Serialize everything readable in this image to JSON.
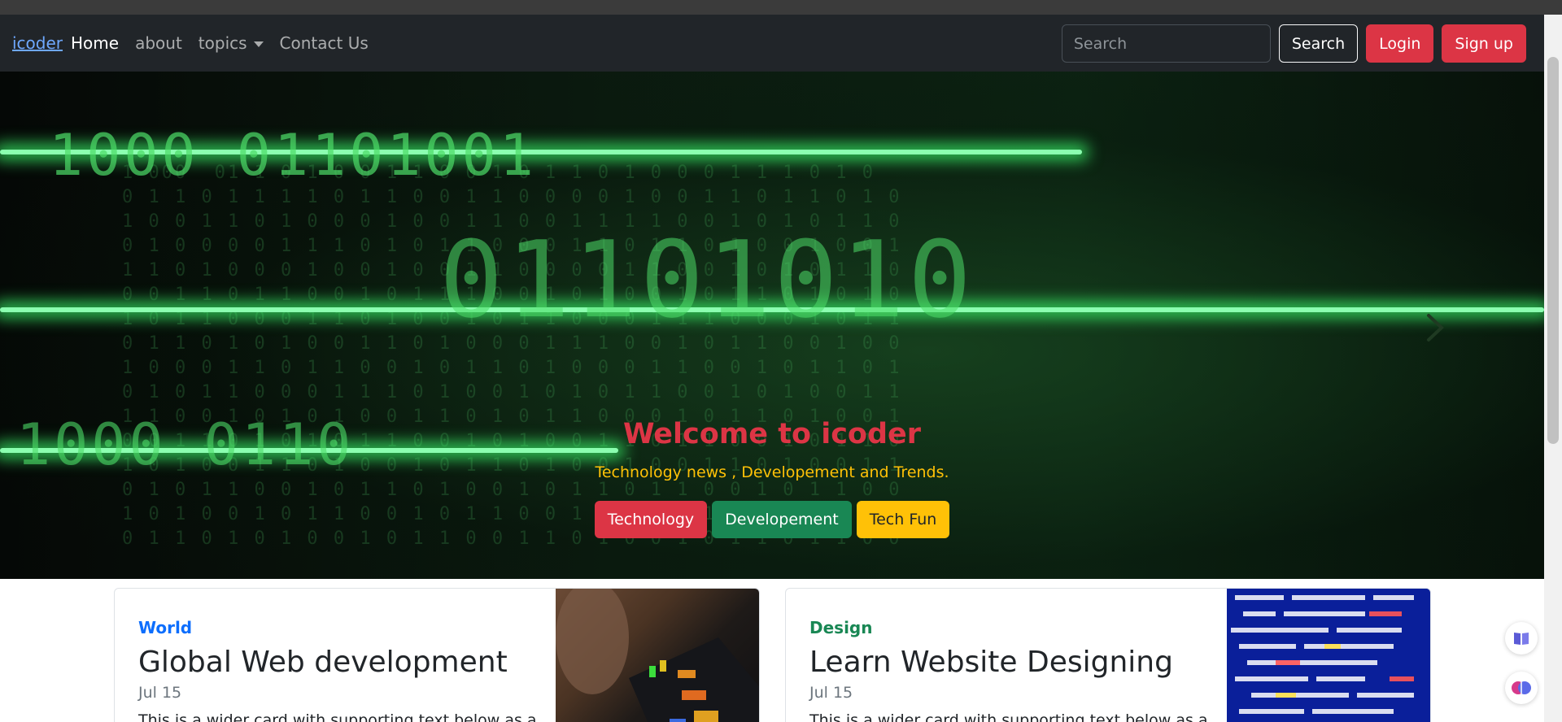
{
  "navbar": {
    "brand": "icoder",
    "links": [
      {
        "label": "Home"
      },
      {
        "label": "about"
      },
      {
        "label": "topics"
      },
      {
        "label": "Contact Us"
      }
    ],
    "search_placeholder": "Search",
    "search_button": "Search",
    "login_button": "Login",
    "signup_button": "Sign up"
  },
  "hero": {
    "title": "Welcome to icoder",
    "subtitle": "Technology news , Developement and Trends.",
    "buttons": [
      {
        "label": "Technology"
      },
      {
        "label": "Developement"
      },
      {
        "label": "Tech Fun"
      }
    ],
    "binary_rows": [
      "1000 01101001",
      "01101010",
      "1000 0110"
    ]
  },
  "cards": [
    {
      "category": "World",
      "title": "Global Web development",
      "date": "Jul 15",
      "text": "This is a wider card with supporting text below as a"
    },
    {
      "category": "Design",
      "title": "Learn Website Designing",
      "date": "Jul 15",
      "text": "This is a wider card with supporting text below as a"
    }
  ],
  "colors": {
    "navbar_bg": "#212529",
    "danger": "#dc3545",
    "success": "#198754",
    "warning": "#ffc107",
    "primary": "#0d6efd"
  }
}
